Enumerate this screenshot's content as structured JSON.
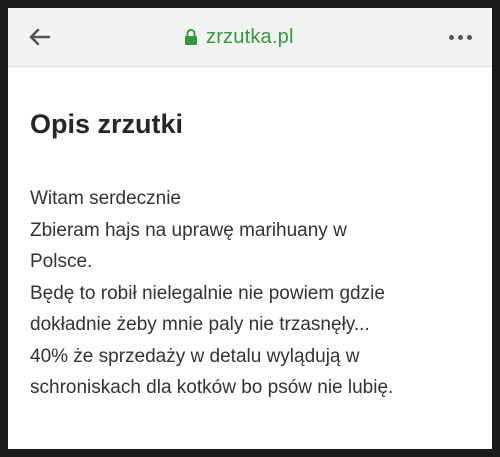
{
  "browser": {
    "url": "zrzutka.pl",
    "icons": {
      "back": "arrow-left-icon",
      "lock": "lock-icon",
      "menu": "more-horizontal-icon"
    },
    "accent_color": "#2f9b3c"
  },
  "page": {
    "title": "Opis zrzutki",
    "description_lines": [
      "Witam serdecznie",
      "Zbieram hajs na uprawę marihuany w",
      "Polsce.",
      "Będę to robił nielegalnie nie powiem gdzie",
      "dokładnie żeby mnie paly nie trzasnęły...",
      "40% że sprzedaży w detalu wylądują w",
      "schroniskach dla kotków bo psów nie lubię."
    ]
  }
}
